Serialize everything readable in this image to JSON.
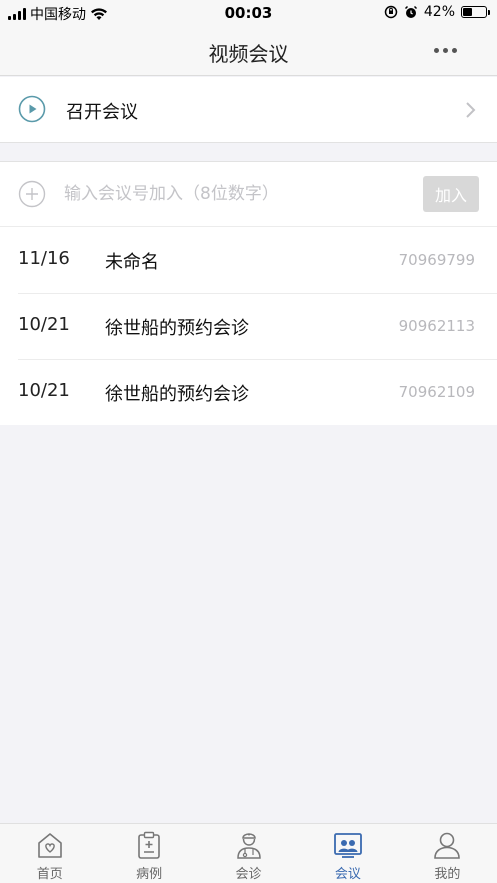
{
  "status_bar": {
    "carrier": "中国移动",
    "time": "00:03",
    "battery": "42%",
    "battery_level": 0.42
  },
  "nav": {
    "title": "视频会议"
  },
  "start_meeting": {
    "label": "召开会议"
  },
  "join": {
    "placeholder": "输入会议号加入（8位数字）",
    "button_label": "加入"
  },
  "meetings": [
    {
      "date": "11/16",
      "name": "未命名",
      "id": "70969799"
    },
    {
      "date": "10/21",
      "name": "徐世船的预约会诊",
      "id": "90962113"
    },
    {
      "date": "10/21",
      "name": "徐世船的预约会诊",
      "id": "70962109"
    }
  ],
  "tabs": [
    {
      "label": "首页",
      "icon": "home-icon"
    },
    {
      "label": "病例",
      "icon": "clipboard-icon"
    },
    {
      "label": "会诊",
      "icon": "doctor-icon"
    },
    {
      "label": "会议",
      "icon": "meeting-icon"
    },
    {
      "label": "我的",
      "icon": "user-icon"
    }
  ],
  "colors": {
    "accent": "#3a6ab0",
    "play_icon": "#5a9aaa"
  }
}
